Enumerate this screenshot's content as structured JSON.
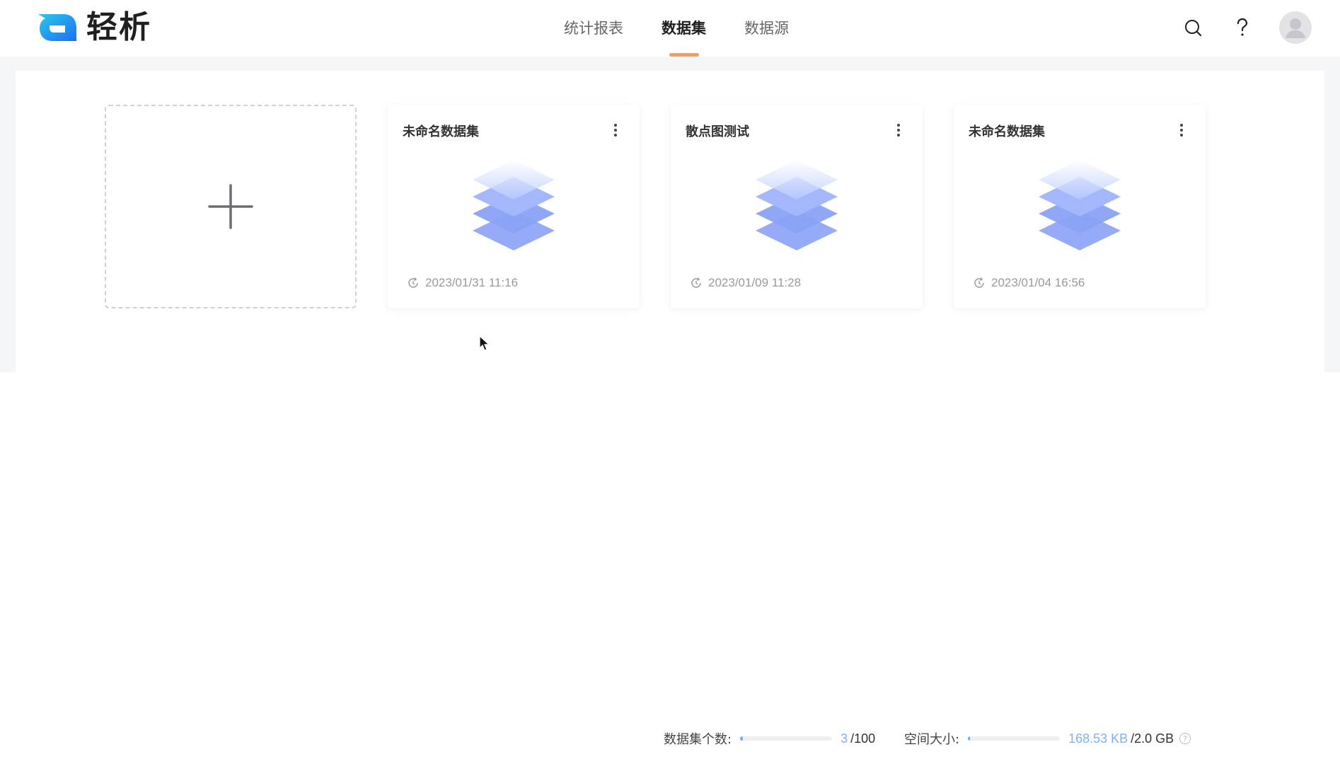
{
  "app": {
    "name": "轻析"
  },
  "nav": {
    "tabs": [
      {
        "label": "统计报表",
        "active": false
      },
      {
        "label": "数据集",
        "active": true
      },
      {
        "label": "数据源",
        "active": false
      }
    ]
  },
  "header": {
    "icons": [
      "search-icon",
      "help-icon",
      "avatar"
    ]
  },
  "datasets": [
    {
      "title": "未命名数据集",
      "updated": "2023/01/31 11:16"
    },
    {
      "title": "散点图测试",
      "updated": "2023/01/09 11:28"
    },
    {
      "title": "未命名数据集",
      "updated": "2023/01/04 16:56"
    }
  ],
  "stats": {
    "count_label": "数据集个数:",
    "count_used": "3",
    "count_total": "/100",
    "count_fraction": 0.03,
    "space_label": "空间大小:",
    "space_used": "168.53 KB",
    "space_total": "/2.0 GB",
    "space_fraction": 0.0001
  },
  "colors": {
    "accent": "#f0a05a",
    "primary_blue": "#6fa8ff",
    "background_band": "#f5f6f8"
  }
}
